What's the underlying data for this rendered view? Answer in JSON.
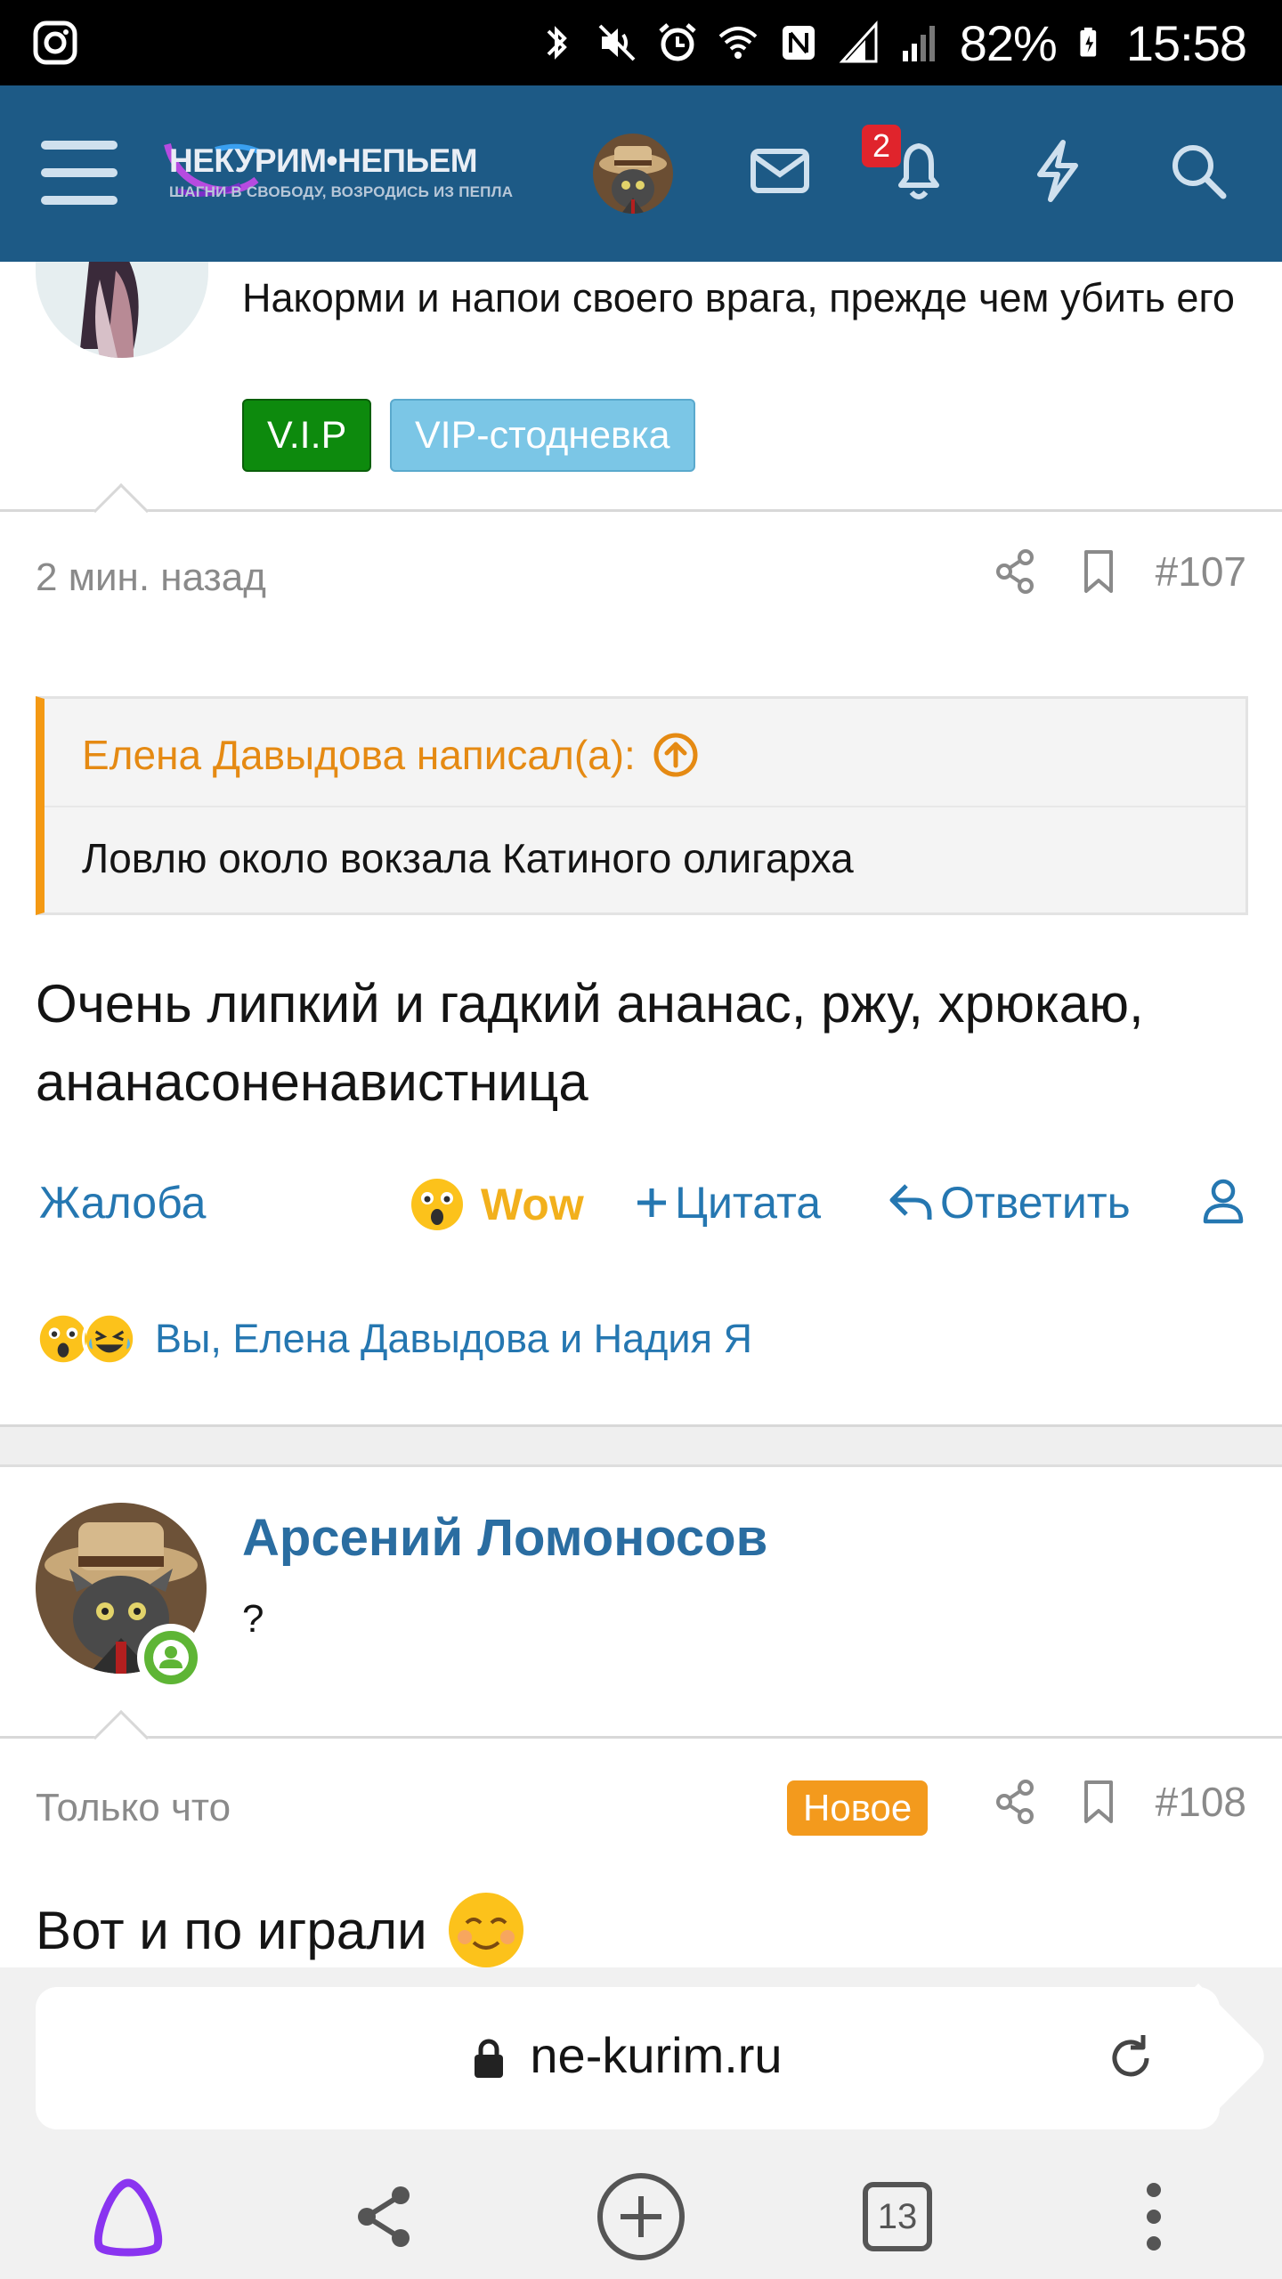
{
  "status_bar": {
    "battery": "82%",
    "time": "15:58"
  },
  "header": {
    "logo_title": "НЕКУРИМ•НЕПЬЕМ",
    "logo_subtitle": "ШАГНИ В СВОБОДУ, ВОЗРОДИСЬ ИЗ ПЕПЛА",
    "notification_count": "2"
  },
  "prev_post": {
    "signature": "Накорми и напои своего врага, прежде чем убить его",
    "tags": [
      "V.I.P",
      "VIP-стодневка"
    ]
  },
  "post107": {
    "time": "2 мин. назад",
    "number": "#107",
    "quote_author": "Елена Давыдова написал(а):",
    "quote_text": "Ловлю около вокзала Катиного олигарха",
    "body": "Очень липкий и гадкий ананас, ржу, хрюкаю, ананасоненавистница",
    "actions": {
      "report": "Жалоба",
      "wow": "Wow",
      "quote": "Цитата",
      "reply": "Ответить"
    },
    "reactions_text": "Вы, Елена Давыдова и Надия Я"
  },
  "post108": {
    "author": "Арсений Ломоносов",
    "author_title": "?",
    "time": "Только что",
    "new_badge": "Новое",
    "number": "#108",
    "body": "Вот и по играли"
  },
  "browser": {
    "url": "ne-kurim.ru",
    "tabs_count": "13"
  },
  "colors": {
    "header_bg": "#1d5a86",
    "link": "#2577b1",
    "quote_accent": "#f49913",
    "vip_green": "#0d8a0d",
    "vip_blue": "#7bc6e6",
    "new_badge": "#f39a1d",
    "online": "#5eb535"
  }
}
